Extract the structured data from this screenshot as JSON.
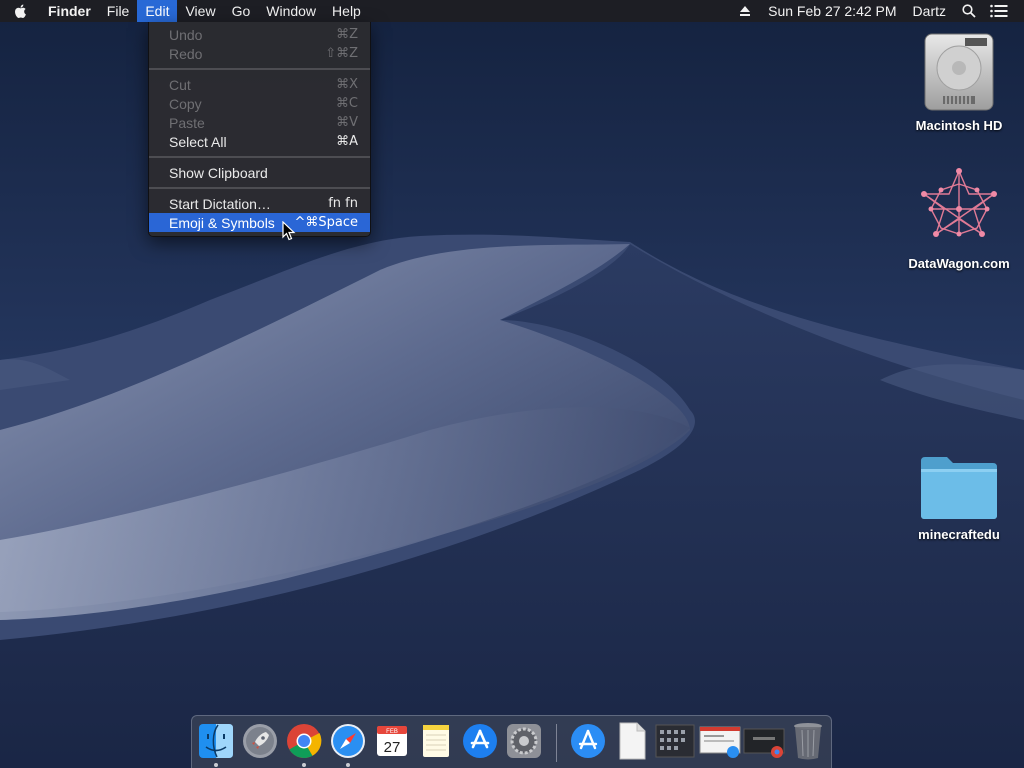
{
  "menubar": {
    "app_name": "Finder",
    "menus": [
      "File",
      "Edit",
      "View",
      "Go",
      "Window",
      "Help"
    ],
    "active_menu": "Edit",
    "datetime": "Sun Feb 27  2:42 PM",
    "user": "Dartz",
    "icons": [
      "apple-logo-icon",
      "eject-icon",
      "spotlight-search-icon",
      "notification-center-icon"
    ]
  },
  "edit_menu": {
    "items": [
      {
        "label": "Undo",
        "shortcut": "⌘Z",
        "enabled": false
      },
      {
        "label": "Redo",
        "shortcut": "⇧⌘Z",
        "enabled": false
      },
      {
        "label": "Cut",
        "shortcut": "⌘X",
        "enabled": false
      },
      {
        "label": "Copy",
        "shortcut": "⌘C",
        "enabled": false
      },
      {
        "label": "Paste",
        "shortcut": "⌘V",
        "enabled": false
      },
      {
        "label": "Select All",
        "shortcut": "⌘A",
        "enabled": true
      },
      {
        "label": "Show Clipboard",
        "shortcut": "",
        "enabled": true
      },
      {
        "label": "Start Dictation…",
        "shortcut": "fn fn",
        "enabled": true
      },
      {
        "label": "Emoji & Symbols",
        "shortcut": "^⌘Space",
        "enabled": true,
        "highlighted": true
      }
    ]
  },
  "desktop_icons": [
    {
      "label": "Macintosh HD",
      "icon": "hard-drive-icon"
    },
    {
      "label": "DataWagon.com",
      "icon": "network-star-icon"
    },
    {
      "label": "minecraftedu",
      "icon": "folder-icon"
    }
  ],
  "dock": {
    "calendar_month": "FEB",
    "calendar_day": "27",
    "items": [
      {
        "name": "finder",
        "icon": "finder-icon",
        "running": true
      },
      {
        "name": "launchpad",
        "icon": "launchpad-rocket-icon",
        "running": false
      },
      {
        "name": "chrome",
        "icon": "chrome-icon",
        "running": true
      },
      {
        "name": "safari",
        "icon": "safari-compass-icon",
        "running": true
      },
      {
        "name": "calendar",
        "icon": "calendar-icon",
        "running": false
      },
      {
        "name": "notes",
        "icon": "notes-icon",
        "running": false
      },
      {
        "name": "app-store",
        "icon": "app-store-icon",
        "running": false
      },
      {
        "name": "system-preferences",
        "icon": "gear-icon",
        "running": false
      },
      {
        "name": "applications-stack",
        "icon": "app-store-folder-icon",
        "running": false
      },
      {
        "name": "document-stack",
        "icon": "document-icon",
        "running": false
      },
      {
        "name": "window-thumbnail-1",
        "icon": "window-thumbnail-icon",
        "running": false
      },
      {
        "name": "window-thumbnail-2",
        "icon": "window-thumbnail-icon",
        "running": false
      },
      {
        "name": "window-thumbnail-3",
        "icon": "window-thumbnail-icon",
        "running": false
      },
      {
        "name": "trash",
        "icon": "trash-icon",
        "running": false
      }
    ]
  },
  "colors": {
    "menu_highlight": "#2a66d6",
    "menubar_bg": "#1e1e22",
    "wallpaper_sky": "#1d3057"
  }
}
